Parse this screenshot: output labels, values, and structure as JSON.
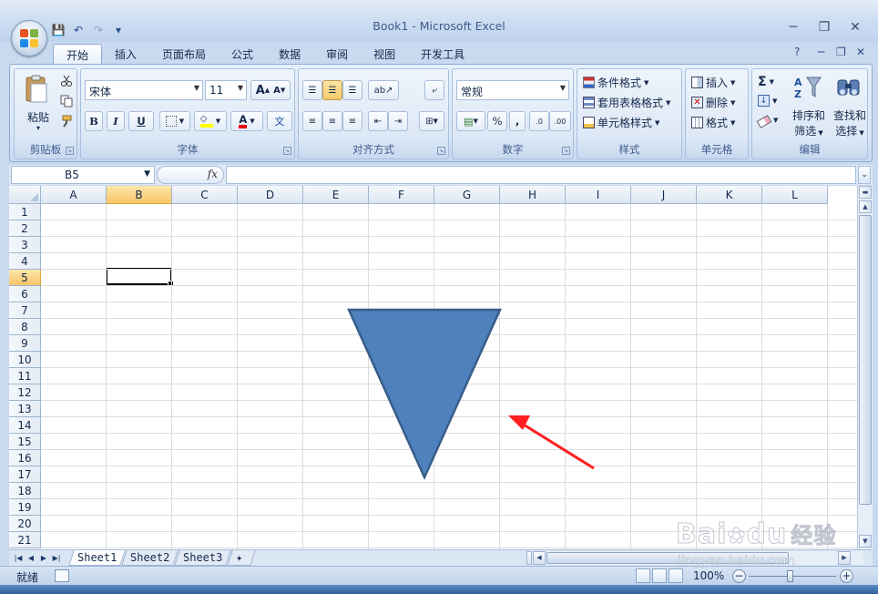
{
  "window": {
    "title": "Book1 - Microsoft Excel",
    "controls": [
      "?",
      "─",
      "❐",
      "✕"
    ]
  },
  "qat": {
    "save": "💾",
    "undo": "↶",
    "redo": "↷",
    "customize": "▾"
  },
  "tabs": [
    "开始",
    "插入",
    "页面布局",
    "公式",
    "数据",
    "审阅",
    "视图",
    "开发工具"
  ],
  "ribbon": {
    "clipboard": {
      "label": "剪贴板",
      "paste": "粘贴"
    },
    "font": {
      "label": "字体",
      "name": "宋体",
      "size": "11",
      "bold": "B",
      "italic": "I",
      "underline": "U",
      "grow": "A",
      "shrink": "A",
      "phonetic": "文"
    },
    "alignment": {
      "label": "对齐方式"
    },
    "number": {
      "label": "数字",
      "format": "常规",
      "percent": "%",
      "comma": ",",
      "inc_decimal": ".0",
      "dec_decimal": ".00"
    },
    "styles": {
      "label": "样式",
      "conditional": "条件格式",
      "table": "套用表格格式",
      "cell": "单元格样式"
    },
    "cells": {
      "label": "单元格",
      "insert": "插入",
      "delete": "删除",
      "format": "格式"
    },
    "editing": {
      "label": "编辑",
      "sort": "排序和",
      "sort2": "筛选",
      "find": "查找和",
      "find2": "选择",
      "sigma": "Σ"
    }
  },
  "formula_bar": {
    "name_box": "B5",
    "fx": "fx",
    "value": ""
  },
  "grid": {
    "columns": [
      "A",
      "B",
      "C",
      "D",
      "E",
      "F",
      "G",
      "H",
      "I",
      "J",
      "K",
      "L"
    ],
    "rows": [
      "1",
      "2",
      "3",
      "4",
      "5",
      "6",
      "7",
      "8",
      "9",
      "10",
      "11",
      "12",
      "13",
      "14",
      "15",
      "16",
      "17",
      "18",
      "19",
      "20",
      "21"
    ],
    "selected_column": "B",
    "selected_row": "5",
    "shape_fill": "#4f81bd",
    "shape_stroke": "#385d8a",
    "arrow_color": "#ff1f1f"
  },
  "sheets": [
    "Sheet1",
    "Sheet2",
    "Sheet3"
  ],
  "status": {
    "ready": "就绪",
    "zoom": "100%",
    "minus": "−",
    "plus": "+"
  },
  "watermark": {
    "brand": "Bai",
    "brand2": "du",
    "cn": "经验",
    "url": "jingyan.baidu.com"
  }
}
